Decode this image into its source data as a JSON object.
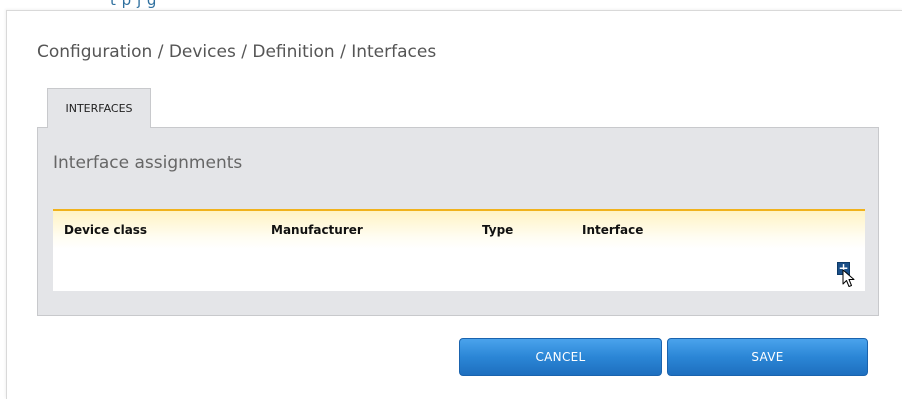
{
  "header": {
    "clipped_text": "t    p      j                     g"
  },
  "breadcrumb": "Configuration / Devices / Definition / Interfaces",
  "tabs": [
    {
      "label": "INTERFACES",
      "active": true
    }
  ],
  "section": {
    "title": "Interface assignments"
  },
  "table": {
    "columns": [
      "Device class",
      "Manufacturer",
      "Type",
      "Interface"
    ],
    "rows": [],
    "add_icon": "plus-icon",
    "add_label": "+"
  },
  "buttons": {
    "cancel": "CANCEL",
    "save": "SAVE"
  },
  "colors": {
    "accent": "#f0b21c",
    "button": "#2b86d6",
    "panel": "#e4e5e8"
  }
}
